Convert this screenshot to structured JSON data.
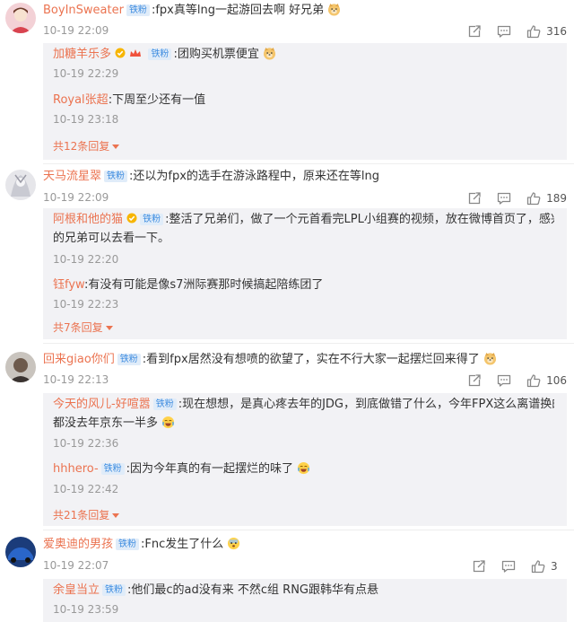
{
  "comments": [
    {
      "user": "BoyInSweater",
      "badge": "铁粉",
      "text": ":fpx真等lng一起游回去啊 好兄弟",
      "emoji": "doge",
      "time": "10-19 22:09",
      "likes": "316",
      "replies": [
        {
          "user": "加糖羊乐多",
          "badge": "铁粉",
          "text": ":团购买机票便宜",
          "time": "10-19 22:29"
        },
        {
          "user": "Royal张超",
          "badge": "",
          "text": ":下周至少还有一值",
          "time": "10-19 23:18"
        }
      ],
      "more": "共12条回复"
    },
    {
      "user": "天马流星翠",
      "badge": "铁粉",
      "text": ":还以为fpx的选手在游泳路程中，原来还在等lng",
      "time": "10-19 22:09",
      "likes": "189",
      "replies": [
        {
          "user": "阿根和他的猫",
          "badge": "铁粉",
          "text": ":整活了兄弟们，做了一个元首看完LPL小组赛的视频，放在微博首页了，感兴趣",
          "text2": "的兄弟可以去看一下。",
          "time": "10-19 22:20"
        },
        {
          "user": "钰fyw",
          "badge": "",
          "text": ":有没有可能是像s7洲际赛那时候搞起陪练团了",
          "time": "10-19 22:23"
        }
      ],
      "more": "共7条回复"
    },
    {
      "user": "回来giao你们",
      "badge": "铁粉",
      "text": ":看到fpx居然没有想喷的欲望了，实在不行大家一起摆烂回来得了",
      "time": "10-19 22:13",
      "likes": "106",
      "replies": [
        {
          "user": "今天的风儿-好喧嚣",
          "badge": "铁粉",
          "text": ":现在想想，是真心疼去年的JDG，到底做错了什么，今年FPX这么离谱换的驽",
          "text2": "都没去年京东一半多",
          "time": "10-19 22:36"
        },
        {
          "user": "hhhero-",
          "badge": "铁粉",
          "text": ":因为今年真的有一起摆烂的味了",
          "time": "10-19 22:42"
        }
      ],
      "more": "共21条回复"
    },
    {
      "user": "爱奥迪的男孩",
      "badge": "铁粉",
      "text": ":Fnc发生了什么",
      "time": "10-19 22:07",
      "likes": "3",
      "replies": [
        {
          "user": "余皇当立",
          "badge": "铁粉",
          "text": ":他们最c的ad没有来 不然c组 RNG跟韩华有点悬",
          "time": "10-19 23:59"
        }
      ]
    }
  ],
  "colors": {
    "username": "#eb7350",
    "badge_bg": "#e0ecf9",
    "badge_fg": "#3f8de0",
    "reply_bg": "#f2f2f5"
  },
  "icons": [
    "share-icon",
    "comment-icon",
    "like-icon",
    "vip-icon",
    "doge-emoji",
    "laugh-cry-emoji",
    "scared-emoji"
  ]
}
